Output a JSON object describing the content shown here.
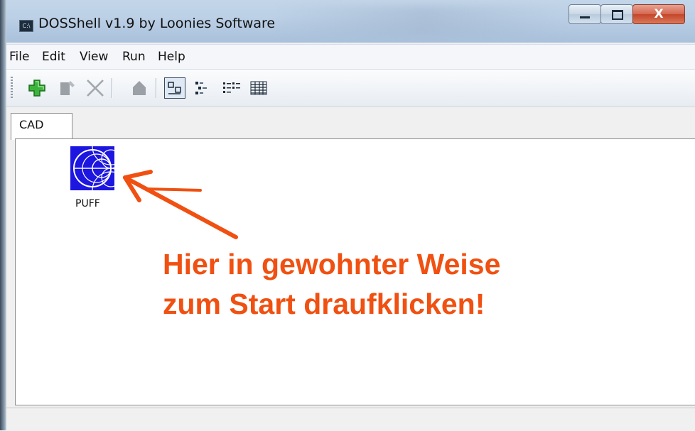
{
  "window": {
    "title": "DOSShell v1.9 by Loonies Software",
    "app_icon_text": "C:\\",
    "controls": {
      "minimize": "minimize",
      "maximize": "maximize",
      "close": "X"
    }
  },
  "menu": {
    "items": [
      "File",
      "Edit",
      "View",
      "Run",
      "Help"
    ]
  },
  "toolbar": {
    "buttons": [
      {
        "icon": "add-icon",
        "enabled": true
      },
      {
        "icon": "edit-icon",
        "enabled": false
      },
      {
        "icon": "delete-icon",
        "enabled": false
      },
      {
        "icon": "properties-icon",
        "enabled": false
      },
      {
        "icon": "large-icons-view-icon",
        "active": true
      },
      {
        "icon": "small-icons-view-icon"
      },
      {
        "icon": "list-view-icon"
      },
      {
        "icon": "details-view-icon"
      }
    ]
  },
  "tabs": [
    {
      "label": "CAD",
      "selected": true
    }
  ],
  "content": {
    "items": [
      {
        "label": "PUFF",
        "icon": "smith-chart-icon"
      }
    ],
    "annotation": {
      "line1": "Hier in gewohnter Weise",
      "line2": "zum Start draufklicken!",
      "color": "#f05011"
    }
  },
  "colors": {
    "accent_annotation": "#f05011",
    "program_icon_bg": "#1c16e0",
    "add_green": "#2fa12f"
  }
}
